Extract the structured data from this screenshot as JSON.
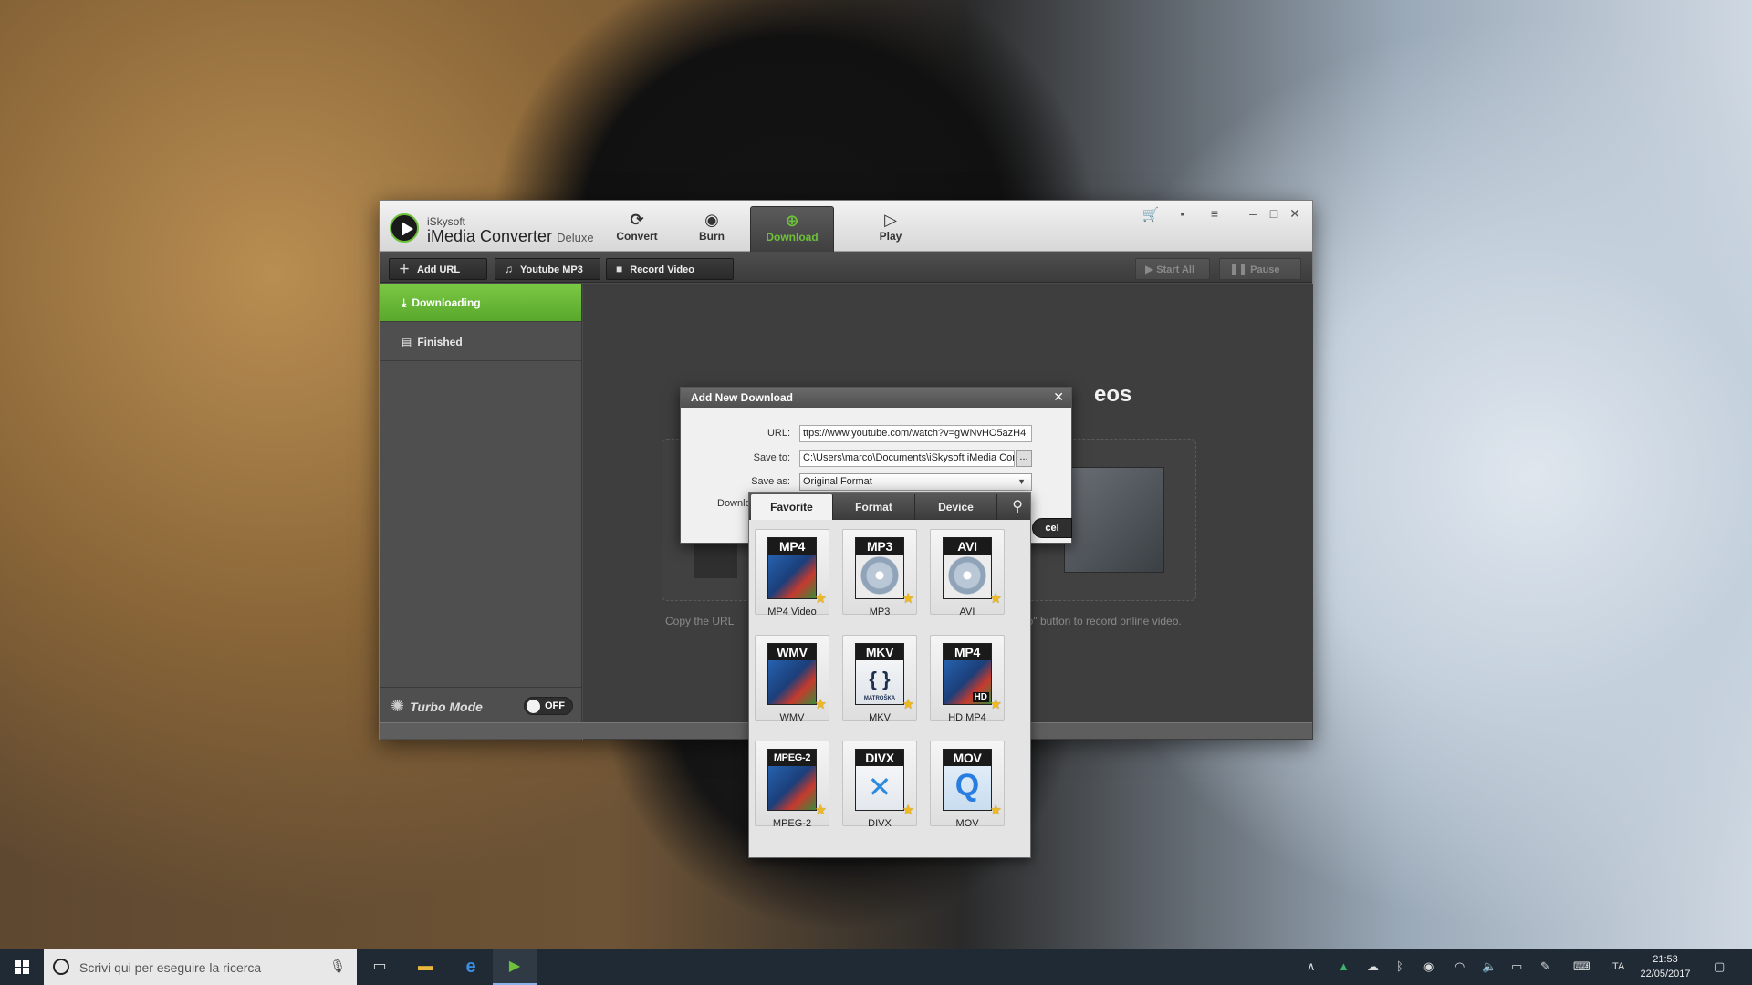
{
  "app": {
    "brand_small": "iSkysoft",
    "brand_name": "iMedia Converter",
    "brand_edition": "Deluxe",
    "nav": [
      {
        "label": "Convert",
        "icon": "convert-icon"
      },
      {
        "label": "Burn",
        "icon": "burn-icon"
      },
      {
        "label": "Download",
        "icon": "download-icon",
        "active": true
      },
      {
        "label": "Play",
        "icon": "play-icon"
      }
    ],
    "accent_color": "#6dc13a"
  },
  "toolbar": {
    "add_url": "Add URL",
    "youtube_mp3": "Youtube MP3",
    "record_video": "Record Video",
    "start_all": "Start All",
    "pause_all": "Pause All"
  },
  "sidebar": {
    "items": [
      {
        "label": "Downloading",
        "active": true
      },
      {
        "label": "Finished",
        "active": false
      }
    ],
    "turbo_label": "Turbo Mode",
    "turbo_state": "OFF"
  },
  "content": {
    "hero_title": "eos",
    "hint_left": "Copy the URL",
    "hint_right": "eo\" button to record online video."
  },
  "dialog": {
    "title": "Add New Download",
    "url_label": "URL:",
    "url_value": "ttps://www.youtube.com/watch?v=gWNvHO5azH4",
    "save_to_label": "Save to:",
    "save_to_value": "C:\\Users\\marco\\Documents\\iSkysoft iMedia Conv",
    "browse": "...",
    "save_as_label": "Save as:",
    "save_as_value": "Original Format",
    "partial_label": "Downlo",
    "cancel_partial": "cel"
  },
  "format_popup": {
    "tabs": [
      "Favorite",
      "Format",
      "Device"
    ],
    "active_tab": "Favorite",
    "formats": [
      {
        "tag": "MP4",
        "label": "MP4 Video"
      },
      {
        "tag": "MP3",
        "label": "MP3"
      },
      {
        "tag": "AVI",
        "label": "AVI"
      },
      {
        "tag": "WMV",
        "label": "WMV"
      },
      {
        "tag": "MKV",
        "label": "MKV",
        "brand": "MATROŠKA"
      },
      {
        "tag": "MP4",
        "label": "HD MP4",
        "badge": "HD"
      },
      {
        "tag": "MPEG-2",
        "label": "MPEG-2"
      },
      {
        "tag": "DIVX",
        "label": "DIVX"
      },
      {
        "tag": "MOV",
        "label": "MOV"
      }
    ]
  },
  "taskbar": {
    "search_placeholder": "Scrivi qui per eseguire la ricerca",
    "language": "ITA",
    "time": "21:53",
    "date": "22/05/2017"
  }
}
